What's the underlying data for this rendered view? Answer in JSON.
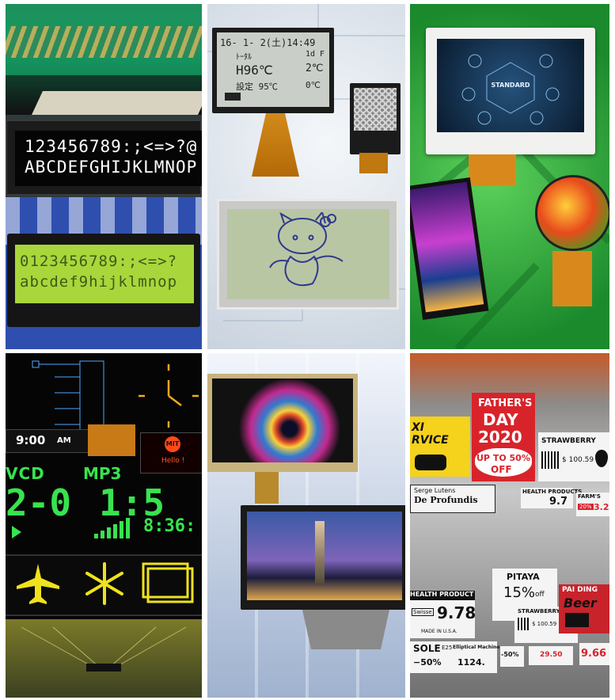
{
  "tiles": {
    "char_lcd": {
      "oled_line1": "123456789:;<=>?@",
      "oled_line2": "ABCDEFGHIJKLMNOP",
      "lcd_line1": "0123456789:;<=>?",
      "lcd_line2": "abcdef9hijklmnop"
    },
    "graphic_lcd": {
      "row1": "16- 1- 2(土)14:49",
      "row2_left": "ﾄｰﾀﾙ",
      "row2_right": "1d F",
      "row3_left": "H96℃",
      "row3_right": "2℃",
      "row4_left": "設定 95℃",
      "row4_right": "0℃"
    },
    "tft": {
      "screen_label": "STANDARD"
    },
    "oled": {
      "time": "9:00",
      "ampm": "AM",
      "vcd": "VCD",
      "mp3": "MP3",
      "digits_left": "2-0",
      "digits_right": "1:5",
      "clock_digits": "8:36:",
      "badge": "MIT",
      "hello": "Hello !"
    },
    "epaper": {
      "taxi_l1": "XI",
      "taxi_l2": "RVICE",
      "fathers_1": "FATHER'S",
      "fathers_2": "DAY",
      "fathers_3": "2020",
      "upto": "UP TO 50%",
      "off": "OFF",
      "straw": "STRAWBERRY",
      "straw_price": "$ 100.59",
      "serge": "Serge Lutens",
      "profundis": "De Profundis",
      "health": "HEALTH PRODUCTS",
      "price_97": "9.7",
      "farms": "FARM'S",
      "farms_disc": "20%",
      "farms_price": "3.2",
      "pitaya": "PITAYA",
      "pitaya_pct": "15%",
      "pitaya_off": "off",
      "health2": "HEALTH PRODUCT",
      "swisse": "Swisse",
      "price_978": "9.78",
      "made_usa": "MADE IN U.S.A.",
      "straw2": "STRAWBERRY",
      "straw2_price": "$ 100.59",
      "paiding": "PAI DING",
      "beer": "Beer",
      "price_966": "9.66",
      "sole": "SOLE",
      "sole_code": "E25",
      "elliptical": "Elliptical Machine",
      "minus50": "−50%",
      "price_1124": "1124.",
      "minus50b": "-50%",
      "price_2950": "29.50"
    }
  }
}
